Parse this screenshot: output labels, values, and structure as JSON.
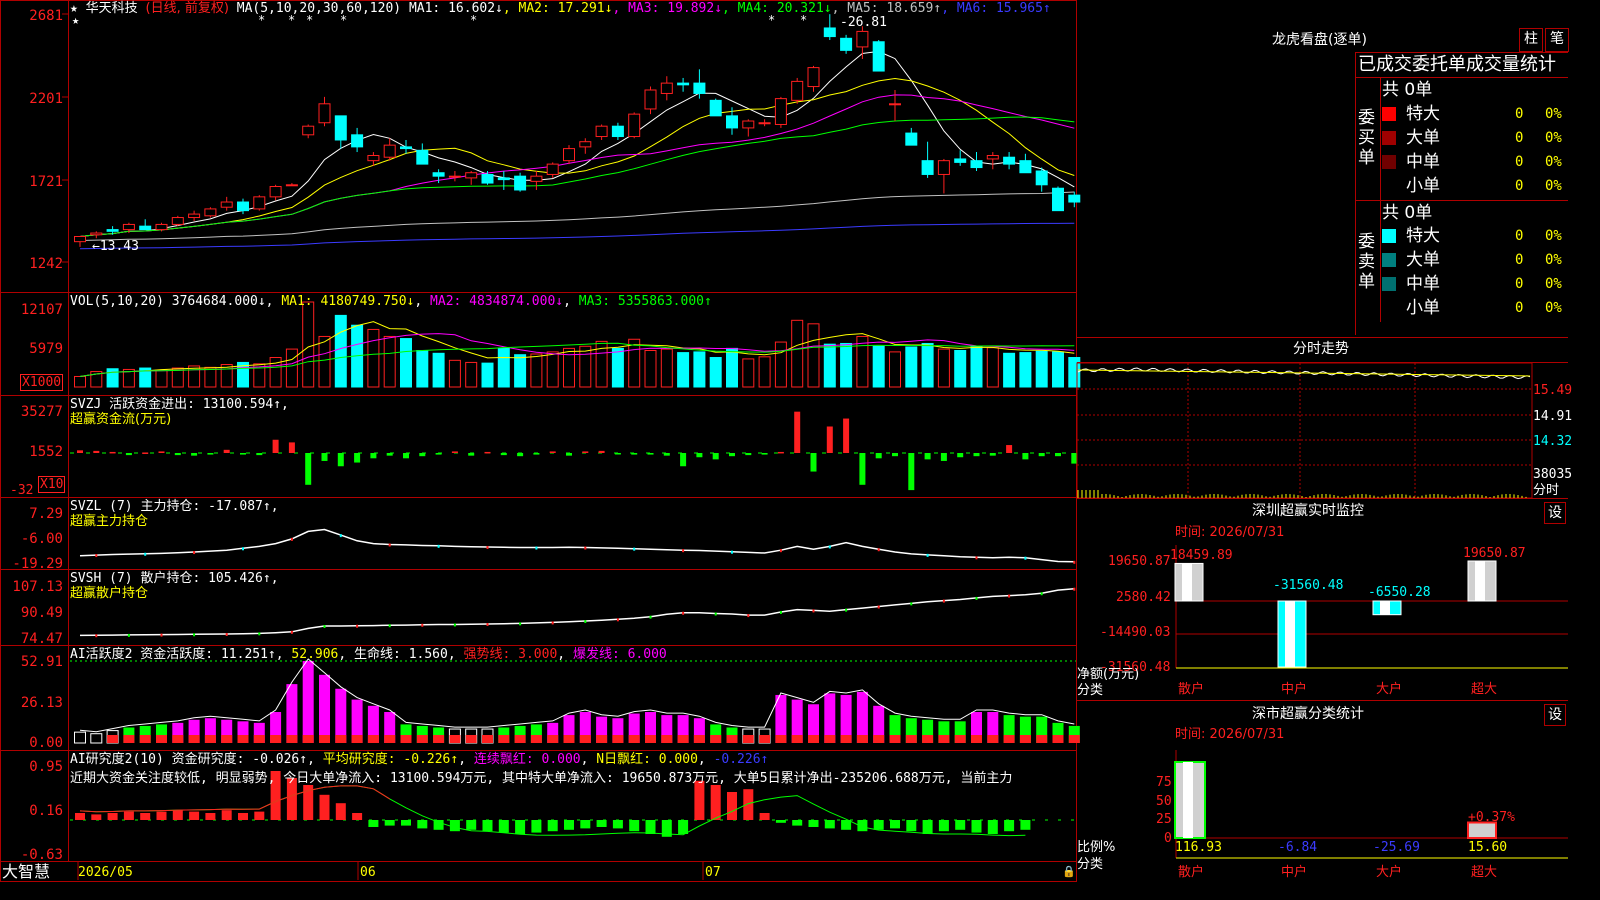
{
  "stock": {
    "name": "华天科技",
    "period": "(日线, 前复权)",
    "stars": "★"
  },
  "colors": {
    "up": "#ff2020",
    "down": "#00ffff",
    "border": "#b00000",
    "bg": "#000000"
  },
  "ma_header": {
    "label": "MA(5,10,20,30,60,120)",
    "items": [
      {
        "text": "MA1: 16.602↓",
        "color": "#ffffff"
      },
      {
        "text": "MA2: 17.291↓",
        "color": "#ffff00"
      },
      {
        "text": "MA3: 19.892↓",
        "color": "#ff00ff"
      },
      {
        "text": "MA4: 20.321↓",
        "color": "#00ff00"
      },
      {
        "text": "MA5: 18.659↑",
        "color": "#c0c0c0"
      },
      {
        "text": "MA6: 15.965↑",
        "color": "#3b3bff"
      }
    ]
  },
  "price_axis": [
    "2681",
    "2201",
    "1721",
    "1242"
  ],
  "price_annotations": {
    "high": "26.81",
    "low": "13.43"
  },
  "vol_header": {
    "label": "VOL(5,10,20)",
    "value": "3764684.000↓",
    "ma1": "MA1: 4180749.750↓",
    "ma2": "MA2: 4834874.000↓",
    "ma3": "MA3: 5355863.000↑"
  },
  "vol_axis": [
    "12107",
    "5979"
  ],
  "vol_unit": "X1000",
  "svzj": {
    "header": "SVZJ  活跃资金进出: 13100.594↑,",
    "sub": "超赢资金流(万元)",
    "axis": [
      "35277",
      "1552",
      "-32"
    ],
    "unit": "X10"
  },
  "svzl": {
    "header": "SVZL (7) 主力持仓: -17.087↑,",
    "sub": "超赢主力持仓",
    "axis": [
      "7.29",
      "-6.00",
      "-19.29"
    ]
  },
  "svsh": {
    "header": "SVSH (7) 散户持仓: 105.426↑,",
    "sub": "超赢散户持仓",
    "axis": [
      "107.13",
      "90.49",
      "74.47"
    ]
  },
  "ai_active": {
    "header_label": "AI活跃度2 资金活跃度:",
    "value": "11.251↑",
    "v2": "52.906",
    "life": "生命线: 1.560",
    "strong": "强势线: 3.000",
    "burst": "爆发线: 6.000",
    "axis": [
      "52.91",
      "26.13",
      "0.00"
    ]
  },
  "ai_research": {
    "header_label": "AI研究度2(10) 资金研究度:",
    "value": "-0.026↑",
    "avg": "平均研究度: -0.226↑",
    "red": "连续飘红: 0.000",
    "nred": "N日飘红: 0.000",
    "last": "-0.226↑",
    "axis": [
      "0.95",
      "0.16",
      "-0.63"
    ],
    "comment": "近期大资金关注度较低, 明显弱势, 今日大单净流入: 13100.594万元, 其中特大单净流入: 19650.873万元, 大单5日累计净出-235206.688万元, 当前主力"
  },
  "date_axis": {
    "brand": "大智慧",
    "labels": [
      "2026/05",
      "06",
      "07"
    ]
  },
  "right": {
    "lhb_title": "龙虎看盘(逐单)",
    "tab1": "柱",
    "tab2": "笔",
    "table_title": "已成交委托单成交量统计",
    "buy": {
      "side": "委买单",
      "total": "共 0单",
      "rows": [
        {
          "name": "特大",
          "v": "0",
          "p": "0%",
          "color": "#ff0000"
        },
        {
          "name": "大单",
          "v": "0",
          "p": "0%",
          "color": "#a00000"
        },
        {
          "name": "中单",
          "v": "0",
          "p": "0%",
          "color": "#700000"
        },
        {
          "name": "小单",
          "v": "0",
          "p": "0%",
          "color": "#000000"
        }
      ]
    },
    "sell": {
      "side": "委卖单",
      "total": "共 0单",
      "rows": [
        {
          "name": "特大",
          "v": "0",
          "p": "0%",
          "color": "#00ffff"
        },
        {
          "name": "大单",
          "v": "0",
          "p": "0%",
          "color": "#008080"
        },
        {
          "name": "中单",
          "v": "0",
          "p": "0%",
          "color": "#007070"
        },
        {
          "name": "小单",
          "v": "0",
          "p": "0%",
          "color": "#000000"
        }
      ]
    },
    "intraday_title": "分时走势",
    "intraday_labels": [
      "15.49",
      "14.91",
      "14.32",
      "38035",
      "分时"
    ],
    "monitor": {
      "title": "深圳超赢实时监控",
      "set": "设",
      "time": "时间: 2026/07/31",
      "axis": [
        "19650.87",
        "2580.42",
        "-14490.03",
        "-31560.48"
      ],
      "bars": [
        {
          "cat": "散户",
          "value": 18459.89,
          "label": "18459.89"
        },
        {
          "cat": "中户",
          "value": -31560.48,
          "label": "-31560.48"
        },
        {
          "cat": "大户",
          "value": -6550.28,
          "label": "-6550.28"
        },
        {
          "cat": "超大",
          "value": 19650.87,
          "label": "19650.87"
        }
      ],
      "ylabel1": "净额(万元)",
      "ylabel2": "分类"
    },
    "classify": {
      "title": "深市超赢分类统计",
      "set": "设",
      "time": "时间: 2026/07/31",
      "axis": [
        "75",
        "50",
        "25",
        "0"
      ],
      "bars": [
        {
          "cat": "散户",
          "value": 116.93,
          "label": "116.93"
        },
        {
          "cat": "中户",
          "value": -6.84,
          "label": "-6.84"
        },
        {
          "cat": "大户",
          "value": -25.69,
          "label": "-25.69"
        },
        {
          "cat": "超大",
          "value": 15.6,
          "label": "15.60",
          "extra": "+0.37%"
        }
      ],
      "ylabel1": "比例%",
      "ylabel2": "分类"
    }
  },
  "chart_data": [
    {
      "type": "candlestick",
      "title": "华天科技",
      "y_range": [
        12.42,
        26.81
      ],
      "candles": [
        [
          13.6,
          13.9,
          13.3,
          13.9
        ],
        [
          14.0,
          14.2,
          13.8,
          14.1
        ],
        [
          14.3,
          14.5,
          14.0,
          14.2
        ],
        [
          14.3,
          14.7,
          14.1,
          14.6
        ],
        [
          14.5,
          14.9,
          14.3,
          14.3
        ],
        [
          14.3,
          14.7,
          14.2,
          14.6
        ],
        [
          14.6,
          15.1,
          14.5,
          15.0
        ],
        [
          15.0,
          15.4,
          14.8,
          15.2
        ],
        [
          15.1,
          15.6,
          15.0,
          15.5
        ],
        [
          15.6,
          16.2,
          15.4,
          15.9
        ],
        [
          15.9,
          16.1,
          15.2,
          15.4
        ],
        [
          15.5,
          16.3,
          15.4,
          16.2
        ],
        [
          16.2,
          16.9,
          16.0,
          16.8
        ],
        [
          16.9,
          17.0,
          16.9,
          16.9
        ],
        [
          19.8,
          20.4,
          19.6,
          20.3
        ],
        [
          20.5,
          22.0,
          20.3,
          21.6
        ],
        [
          20.9,
          20.9,
          19.0,
          19.5
        ],
        [
          19.8,
          20.2,
          18.8,
          19.1
        ],
        [
          18.3,
          18.8,
          18.0,
          18.6
        ],
        [
          18.5,
          19.6,
          18.3,
          19.2
        ],
        [
          19.1,
          19.5,
          18.7,
          19.0
        ],
        [
          18.9,
          19.3,
          18.1,
          18.1
        ],
        [
          17.6,
          17.8,
          17.0,
          17.4
        ],
        [
          17.4,
          17.7,
          17.1,
          17.4
        ],
        [
          17.3,
          17.7,
          16.9,
          17.6
        ],
        [
          17.5,
          17.7,
          16.9,
          17.0
        ],
        [
          17.3,
          17.7,
          16.6,
          17.2
        ],
        [
          17.4,
          17.6,
          16.5,
          16.6
        ],
        [
          17.1,
          17.7,
          16.6,
          17.4
        ],
        [
          17.5,
          18.2,
          17.3,
          18.1
        ],
        [
          18.3,
          19.2,
          18.1,
          19.0
        ],
        [
          19.1,
          19.6,
          18.7,
          19.4
        ],
        [
          19.7,
          20.4,
          19.5,
          20.3
        ],
        [
          20.3,
          20.5,
          19.5,
          19.7
        ],
        [
          19.7,
          21.1,
          19.6,
          21.0
        ],
        [
          21.3,
          22.6,
          21.0,
          22.4
        ],
        [
          22.2,
          23.2,
          21.8,
          22.8
        ],
        [
          22.8,
          23.1,
          22.3,
          22.7
        ],
        [
          22.8,
          23.6,
          21.9,
          22.2
        ],
        [
          21.8,
          21.9,
          20.9,
          20.9
        ],
        [
          20.9,
          21.4,
          19.8,
          20.2
        ],
        [
          20.2,
          20.7,
          19.7,
          20.6
        ],
        [
          20.5,
          20.7,
          20.3,
          20.5
        ],
        [
          20.4,
          22.0,
          20.2,
          21.9
        ],
        [
          21.8,
          23.1,
          21.6,
          22.9
        ],
        [
          22.6,
          23.8,
          22.3,
          23.7
        ],
        [
          26.0,
          26.8,
          25.3,
          25.5
        ],
        [
          25.4,
          25.6,
          24.5,
          24.7
        ],
        [
          24.9,
          26.1,
          24.2,
          25.8
        ],
        [
          25.2,
          25.3,
          23.5,
          23.5
        ],
        [
          21.6,
          22.4,
          20.6,
          21.6
        ],
        [
          19.9,
          20.2,
          19.2,
          19.2
        ],
        [
          18.3,
          19.4,
          17.3,
          17.5
        ],
        [
          17.5,
          18.4,
          16.4,
          18.3
        ],
        [
          18.4,
          18.9,
          18.0,
          18.2
        ],
        [
          18.3,
          18.8,
          17.7,
          17.9
        ],
        [
          18.4,
          18.8,
          17.8,
          18.6
        ],
        [
          18.5,
          18.8,
          17.8,
          18.1
        ],
        [
          18.3,
          18.7,
          17.6,
          17.6
        ],
        [
          17.7,
          17.9,
          16.5,
          16.9
        ],
        [
          16.7,
          16.8,
          15.4,
          15.4
        ],
        [
          16.3,
          16.5,
          15.6,
          15.9
        ]
      ]
    },
    {
      "type": "bar",
      "title": "VOL",
      "unit": "X1000",
      "values": [
        1500,
        2200,
        2600,
        2500,
        2700,
        2400,
        2700,
        3000,
        2800,
        3200,
        3500,
        3300,
        4200,
        5400,
        12107,
        7200,
        10200,
        8800,
        8200,
        7200,
        6900,
        5200,
        4800,
        3800,
        3500,
        3400,
        5500,
        4600,
        4700,
        5000,
        5500,
        5800,
        6500,
        5500,
        6800,
        5200,
        5400,
        4900,
        5000,
        4200,
        5500,
        4000,
        4300,
        6400,
        9500,
        9000,
        6100,
        6200,
        7200,
        5800,
        5000,
        5700,
        6200,
        5400,
        5200,
        5800,
        5600,
        4800,
        4900,
        5100,
        5000,
        4200
      ]
    },
    {
      "type": "bar",
      "title": "SVZJ",
      "values": [
        0.5,
        0.4,
        0.2,
        -0.4,
        0.1,
        0.3,
        -0.4,
        -0.5,
        -0.3,
        0.6,
        -0.3,
        -0.4,
        2.5,
        2.0,
        -6.0,
        -1.5,
        -2.5,
        -1.8,
        -1.0,
        -0.5,
        -1.0,
        -0.6,
        -0.3,
        0.3,
        -0.5,
        0.2,
        -0.4,
        -0.6,
        -0.3,
        0.3,
        -0.5,
        0.3,
        0.4,
        -0.2,
        -0.3,
        -0.3,
        -0.5,
        -2.5,
        -0.8,
        -1.2,
        -0.6,
        -0.4,
        -0.3,
        0.2,
        7.8,
        -3.5,
        5.0,
        6.5,
        -6.0,
        -1.0,
        -0.6,
        -7.0,
        -1.2,
        -1.5,
        -0.8,
        -0.6,
        -0.5,
        1.5,
        -1.2,
        -0.6,
        -0.6,
        -2.0
      ]
    },
    {
      "type": "line",
      "title": "SVZL",
      "values": [
        -16.0,
        -15.6,
        -15.3,
        -15.1,
        -14.9,
        -14.7,
        -14.4,
        -14.0,
        -13.5,
        -13.0,
        -12.0,
        -11.0,
        -9.5,
        -7.0,
        -3.0,
        -2.0,
        -5.0,
        -8.0,
        -9.5,
        -10.0,
        -10.2,
        -10.5,
        -10.7,
        -11.0,
        -11.2,
        -11.3,
        -11.5,
        -11.6,
        -11.6,
        -11.6,
        -11.5,
        -11.6,
        -11.8,
        -12.0,
        -12.2,
        -12.5,
        -12.8,
        -13.0,
        -13.2,
        -13.5,
        -13.8,
        -14.2,
        -14.5,
        -13.0,
        -11.0,
        -12.5,
        -11.0,
        -9.0,
        -11.0,
        -12.5,
        -14.0,
        -15.0,
        -15.5,
        -16.0,
        -16.5,
        -16.8,
        -17.0,
        -16.8,
        -17.0,
        -18.0,
        -19.0,
        -19.2
      ]
    },
    {
      "type": "line",
      "title": "SVSH",
      "values": [
        75.5,
        75.6,
        75.7,
        75.8,
        75.9,
        76.0,
        76.1,
        76.2,
        76.3,
        76.4,
        76.6,
        76.8,
        77.2,
        77.8,
        80.0,
        81.5,
        81.5,
        81.7,
        81.8,
        82.0,
        82.1,
        82.3,
        82.5,
        82.5,
        82.6,
        82.8,
        83.0,
        83.2,
        83.5,
        83.8,
        84.2,
        84.7,
        85.2,
        85.8,
        86.5,
        87.5,
        89.0,
        90.0,
        90.0,
        89.5,
        89.2,
        88.5,
        88.5,
        90.5,
        92.0,
        91.5,
        91.0,
        92.0,
        93.0,
        94.0,
        95.0,
        96.0,
        97.0,
        97.8,
        98.5,
        99.5,
        100.5,
        101.0,
        101.5,
        102.5,
        104.5,
        105.4
      ]
    },
    {
      "type": "bar",
      "title": "AI活跃度2",
      "values": [
        7,
        6,
        8,
        10,
        11,
        12,
        13,
        15,
        16,
        15,
        14,
        13,
        20,
        38,
        52.9,
        44,
        35,
        28,
        24,
        20,
        12,
        11,
        10,
        9,
        9,
        9,
        10,
        11,
        12,
        13,
        18,
        20,
        17,
        16,
        19,
        20,
        18,
        18,
        16,
        12,
        10,
        9,
        9,
        31,
        28,
        25,
        32,
        31,
        33,
        24,
        18,
        16,
        15,
        14,
        14,
        20,
        20,
        18,
        17,
        17,
        13,
        11
      ]
    },
    {
      "type": "bar",
      "title": "AI研究度2",
      "values": [
        0.05,
        0.04,
        0.05,
        0.06,
        0.05,
        0.06,
        0.07,
        0.06,
        0.05,
        0.07,
        0.05,
        0.06,
        0.35,
        0.3,
        0.25,
        0.18,
        0.12,
        0.05,
        -0.05,
        -0.04,
        -0.04,
        -0.06,
        -0.07,
        -0.08,
        -0.07,
        -0.08,
        -0.09,
        -0.1,
        -0.09,
        -0.08,
        -0.07,
        -0.06,
        -0.05,
        -0.06,
        -0.08,
        -0.1,
        -0.12,
        -0.1,
        0.28,
        0.25,
        0.2,
        0.22,
        0.05,
        -0.02,
        -0.04,
        -0.05,
        -0.06,
        -0.07,
        -0.08,
        -0.07,
        -0.06,
        -0.08,
        -0.1,
        -0.08,
        -0.07,
        -0.09,
        -0.1,
        -0.08,
        -0.07
      ]
    }
  ]
}
